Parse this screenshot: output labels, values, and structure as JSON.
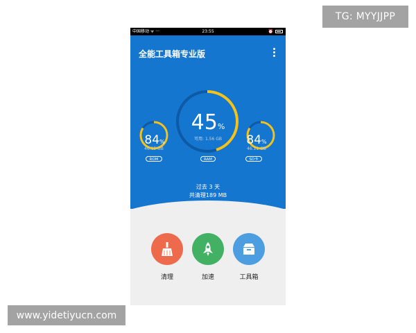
{
  "watermarks": {
    "top": "TG: MYYJJPP",
    "bottom": "www.yidetiyucn.com"
  },
  "statusbar": {
    "left": "中国移动 ᯤ ···",
    "time": "23:55"
  },
  "app": {
    "title": "全能工具箱专业版"
  },
  "gauges": [
    {
      "id": "rom",
      "percent": "84",
      "unit": "%",
      "sub": "46.15 GB",
      "label": "ROM",
      "fraction": 0.84
    },
    {
      "id": "ram",
      "percent": "45",
      "unit": "%",
      "sub": "可用: 1.56 GB",
      "label": "RAM",
      "fraction": 0.45
    },
    {
      "id": "sd",
      "percent": "84",
      "unit": "%",
      "sub": "46.11 GB",
      "label": "SD卡",
      "fraction": 0.84
    }
  ],
  "summary": {
    "line1": "过去 3 天",
    "line2": "共清理189 MB"
  },
  "actions": [
    {
      "label": "清理",
      "color": "#ee6a4c",
      "icon": "broom-icon"
    },
    {
      "label": "加速",
      "color": "#43b164",
      "icon": "rocket-icon"
    },
    {
      "label": "工具箱",
      "color": "#4d9ee0",
      "icon": "toolbox-icon"
    }
  ],
  "colors": {
    "hero": "#1576cf",
    "arc_fill": "#f5c21b",
    "arc_track": "#0d5aa6"
  }
}
